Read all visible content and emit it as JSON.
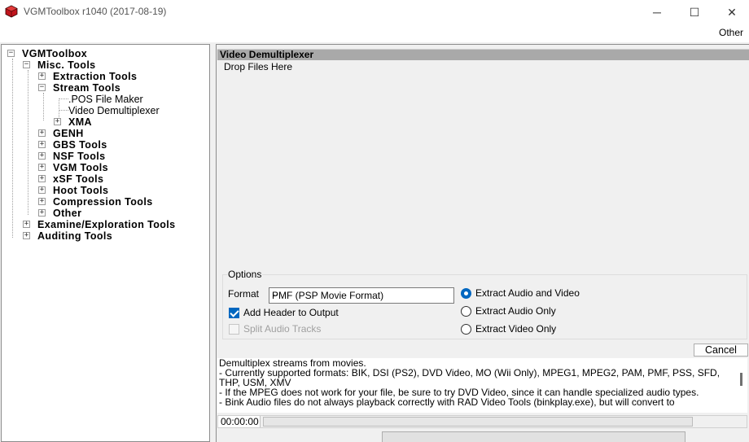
{
  "window": {
    "title": "VGMToolbox r1040 (2017-08-19)",
    "icon": "vgmtoolbox-cube-icon",
    "controls": {
      "minimize": "─",
      "maximize": "☐",
      "close": "✕"
    }
  },
  "menu": {
    "items": [
      "Other"
    ]
  },
  "tree": {
    "root": "VGMToolbox",
    "misc": "Misc. Tools",
    "extraction": "Extraction Tools",
    "stream": "Stream Tools",
    "pos_maker": ".POS File Maker",
    "video_demux": "Video Demultiplexer",
    "xma": "XMA",
    "genh": "GENH",
    "gbs": "GBS Tools",
    "nsf": "NSF Tools",
    "vgm": "VGM Tools",
    "xsf": "xSF Tools",
    "hoot": "Hoot Tools",
    "compression": "Compression Tools",
    "other": "Other",
    "examine": "Examine/Exploration Tools",
    "auditing": "Auditing Tools",
    "expand_symbol": "+",
    "collapse_symbol": "−"
  },
  "panel": {
    "header": "Video Demultiplexer",
    "drop_label": "Drop Files Here",
    "options": {
      "title": "Options",
      "format_label": "Format",
      "format_value": "PMF (PSP Movie Format)",
      "add_header_label": "Add Header to Output",
      "add_header_checked": true,
      "split_audio_label": "Split Audio Tracks",
      "split_audio_enabled": false,
      "radios": [
        {
          "label": "Extract Audio and Video",
          "checked": true
        },
        {
          "label": "Extract Audio Only",
          "checked": false
        },
        {
          "label": "Extract Video Only",
          "checked": false
        }
      ]
    },
    "cancel_label": "Cancel",
    "description": [
      "Demultiplex streams from movies.",
      "- Currently supported formats: BIK, DSI (PS2), DVD Video, MO (Wii Only), MPEG1, MPEG2, PAM, PMF, PSS, SFD, THP, USM, XMV",
      "- If the MPEG does not work for your file, be sure to try DVD Video, since it can handle specialized audio types.",
      "- Bink Audio files do not always playback correctly with RAD Video Tools (binkplay.exe), but will convert to"
    ],
    "status_time": "00:00:00"
  },
  "colors": {
    "accent": "#0067c0",
    "header_bar": "#a9a9a9",
    "icon_red": "#c0141c"
  }
}
